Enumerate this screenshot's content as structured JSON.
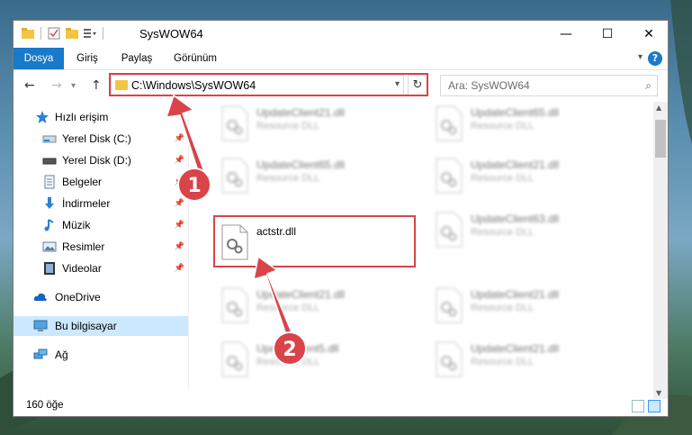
{
  "window": {
    "title": "SysWOW64",
    "minimize_glyph": "—",
    "maximize_glyph": "☐",
    "close_glyph": "✕"
  },
  "ribbon": {
    "tabs": [
      "Dosya",
      "Giriş",
      "Paylaş",
      "Görünüm"
    ],
    "help_glyph": "?"
  },
  "navigation": {
    "address_path": "C:\\Windows\\SysWOW64",
    "search_placeholder": "Ara: SysWOW64"
  },
  "sidebar": {
    "items": [
      {
        "label": "Hızlı erişim",
        "icon": "star-icon",
        "pinned": false
      },
      {
        "label": "Yerel Disk (C:)",
        "icon": "drive-icon",
        "pinned": true
      },
      {
        "label": "Yerel Disk (D:)",
        "icon": "drive-icon",
        "pinned": true
      },
      {
        "label": "Belgeler",
        "icon": "documents-icon",
        "pinned": true
      },
      {
        "label": "İndirmeler",
        "icon": "download-icon",
        "pinned": true
      },
      {
        "label": "Müzik",
        "icon": "music-icon",
        "pinned": true
      },
      {
        "label": "Resimler",
        "icon": "pictures-icon",
        "pinned": true
      },
      {
        "label": "Videolar",
        "icon": "videos-icon",
        "pinned": true
      },
      {
        "label": "OneDrive",
        "icon": "cloud-icon",
        "pinned": false
      },
      {
        "label": "Bu bilgisayar",
        "icon": "computer-icon",
        "pinned": false
      },
      {
        "label": "Ağ",
        "icon": "network-icon",
        "pinned": false
      }
    ]
  },
  "files": [
    {
      "name": "UpdateClient21.dll",
      "type": "Resource DLL"
    },
    {
      "name": "UpdateClient65.dll",
      "type": "Resource DLL"
    },
    {
      "name": "UpdateClient65.dll",
      "type": "Resource DLL"
    },
    {
      "name": "UpdateClient21.dll",
      "type": "Resource DLL"
    },
    {
      "name": "actstr.dll",
      "type": ""
    },
    {
      "name": "UpdateClient63.dll",
      "type": "Resource DLL"
    },
    {
      "name": "UpdateClient21.dll",
      "type": "Resource DLL"
    },
    {
      "name": "UpdateClient21.dll",
      "type": "Resource DLL"
    },
    {
      "name": "UpdateClient5.dll",
      "type": "Resource DLL"
    },
    {
      "name": "UpdateClient21.dll",
      "type": "Resource DLL"
    }
  ],
  "status": {
    "item_count": "160 öğe"
  },
  "annotations": {
    "badge_1": "1",
    "badge_2": "2",
    "color": "#d9434a"
  }
}
